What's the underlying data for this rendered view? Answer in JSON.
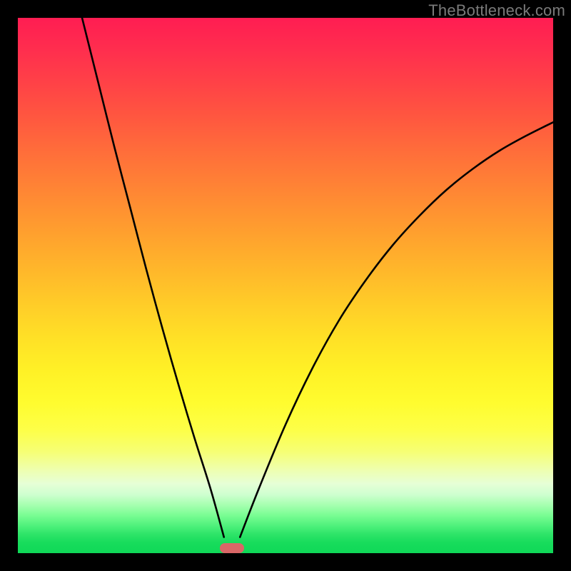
{
  "watermark": "TheBottleneck.com",
  "colors": {
    "frame": "#000000",
    "curve": "#000000",
    "marker": "#d96767",
    "gradient_top": "#ff1d52",
    "gradient_bottom": "#0fd857"
  },
  "chart_data": {
    "type": "line",
    "title": "",
    "xlabel": "",
    "ylabel": "",
    "xlim": [
      0,
      100
    ],
    "ylim": [
      0,
      100
    ],
    "legend": false,
    "grid": false,
    "annotations": [
      {
        "name": "minimum-marker",
        "x": 40,
        "y": 1,
        "shape": "rounded-rect",
        "color": "#d96767"
      }
    ],
    "series": [
      {
        "name": "left-branch",
        "x": [
          12.0,
          15.0,
          18.0,
          21.0,
          24.0,
          27.0,
          30.0,
          33.0,
          36.0,
          38.5
        ],
        "y": [
          100.0,
          88.0,
          76.0,
          64.5,
          53.0,
          42.0,
          31.5,
          21.5,
          12.0,
          3.0
        ]
      },
      {
        "name": "right-branch",
        "x": [
          41.5,
          45.0,
          50.0,
          55.0,
          60.0,
          65.0,
          70.0,
          75.0,
          80.0,
          85.0,
          90.0,
          95.0,
          100.0
        ],
        "y": [
          3.0,
          12.0,
          24.0,
          34.5,
          43.5,
          51.0,
          57.5,
          63.0,
          67.8,
          71.8,
          75.2,
          78.0,
          80.5
        ]
      }
    ]
  }
}
